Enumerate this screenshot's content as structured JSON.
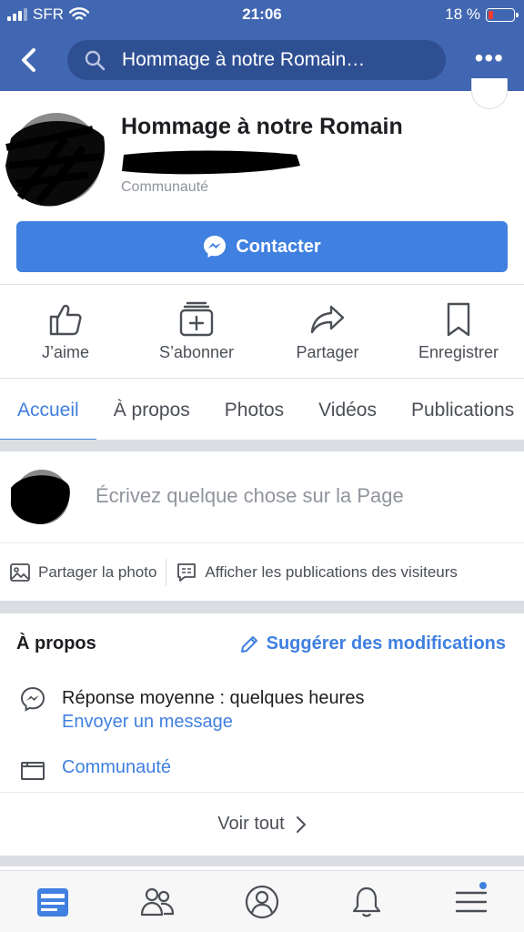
{
  "status_bar": {
    "carrier": "SFR",
    "time": "21:06",
    "battery_percent": "18 %",
    "battery_level": 0.18
  },
  "nav": {
    "search_text": "Hommage à notre Romain…",
    "more_label": "•••"
  },
  "profile": {
    "page_name": "Hommage à notre Romain",
    "category": "Communauté",
    "contact_label": "Contacter"
  },
  "actions": [
    {
      "label": "J’aime",
      "icon": "thumbs-up-icon"
    },
    {
      "label": "S’abonner",
      "icon": "follow-icon"
    },
    {
      "label": "Partager",
      "icon": "share-icon"
    },
    {
      "label": "Enregistrer",
      "icon": "bookmark-icon"
    }
  ],
  "tabs": [
    "Accueil",
    "À propos",
    "Photos",
    "Vidéos",
    "Publications"
  ],
  "composer": {
    "placeholder": "Écrivez quelque chose sur la Page",
    "share_photo": "Partager la photo",
    "visitor_posts": "Afficher les publications des visiteurs"
  },
  "about": {
    "title": "À propos",
    "suggest": "Suggérer des modifications",
    "response_time": "Réponse moyenne : quelques heures",
    "send_message": "Envoyer un message",
    "category": "Communauté",
    "see_all": "Voir tout"
  },
  "bottom_bar": [
    "news-feed-icon",
    "friends-icon",
    "profile-icon",
    "notifications-icon",
    "menu-icon"
  ],
  "colors": {
    "brand_blue": "#4267b2",
    "accent_blue": "#4080e0"
  }
}
